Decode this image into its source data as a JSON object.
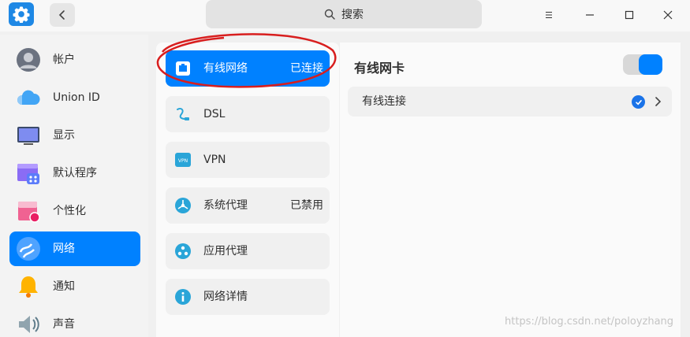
{
  "search": {
    "label": "搜索"
  },
  "sidebar": {
    "items": [
      {
        "label": "帐户",
        "icon": "account-icon"
      },
      {
        "label": "Union ID",
        "icon": "cloud-icon"
      },
      {
        "label": "显示",
        "icon": "display-icon"
      },
      {
        "label": "默认程序",
        "icon": "default-apps-icon"
      },
      {
        "label": "个性化",
        "icon": "personalization-icon"
      },
      {
        "label": "网络",
        "icon": "network-icon",
        "active": true
      },
      {
        "label": "通知",
        "icon": "bell-icon"
      },
      {
        "label": "声音",
        "icon": "speaker-icon"
      }
    ]
  },
  "network_list": {
    "items": [
      {
        "label": "有线网络",
        "status": "已连接",
        "icon": "wired-icon",
        "active": true
      },
      {
        "label": "DSL",
        "status": "",
        "icon": "dsl-icon"
      },
      {
        "label": "VPN",
        "status": "",
        "icon": "vpn-icon"
      },
      {
        "label": "系统代理",
        "status": "已禁用",
        "icon": "system-proxy-icon"
      },
      {
        "label": "应用代理",
        "status": "",
        "icon": "app-proxy-icon"
      },
      {
        "label": "网络详情",
        "status": "",
        "icon": "info-icon"
      }
    ]
  },
  "detail": {
    "title": "有线网卡",
    "toggle_on": true,
    "connection_label": "有线连接"
  },
  "watermark": "https://blog.csdn.net/poloyzhang",
  "colors": {
    "accent": "#0081ff",
    "annotation": "#d81e1e"
  }
}
